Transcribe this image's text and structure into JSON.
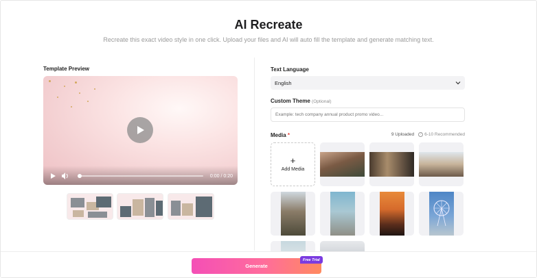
{
  "header": {
    "title": "AI Recreate",
    "subtitle": "Recreate this exact video style in one click. Upload your files and AI will auto fill the template and generate matching text."
  },
  "preview": {
    "label": "Template Preview",
    "time": "0:00 / 0:20",
    "progress": 0.0
  },
  "text_language": {
    "label": "Text Language",
    "selected": "English"
  },
  "custom_theme": {
    "label": "Custom Theme",
    "optional": "(Optional)",
    "placeholder": "Example: tech company annual product promo video..."
  },
  "media": {
    "label": "Media",
    "required_mark": "*",
    "uploaded": "9 Uploaded",
    "recommended": "6-10 Recommended",
    "add_label": "Add Media"
  },
  "actions": {
    "generate": "Generate",
    "badge": "Free Trial"
  },
  "colors": {
    "accent_start": "#f44fb6",
    "accent_end": "#ff8a5f",
    "badge": "#7a3be0"
  }
}
